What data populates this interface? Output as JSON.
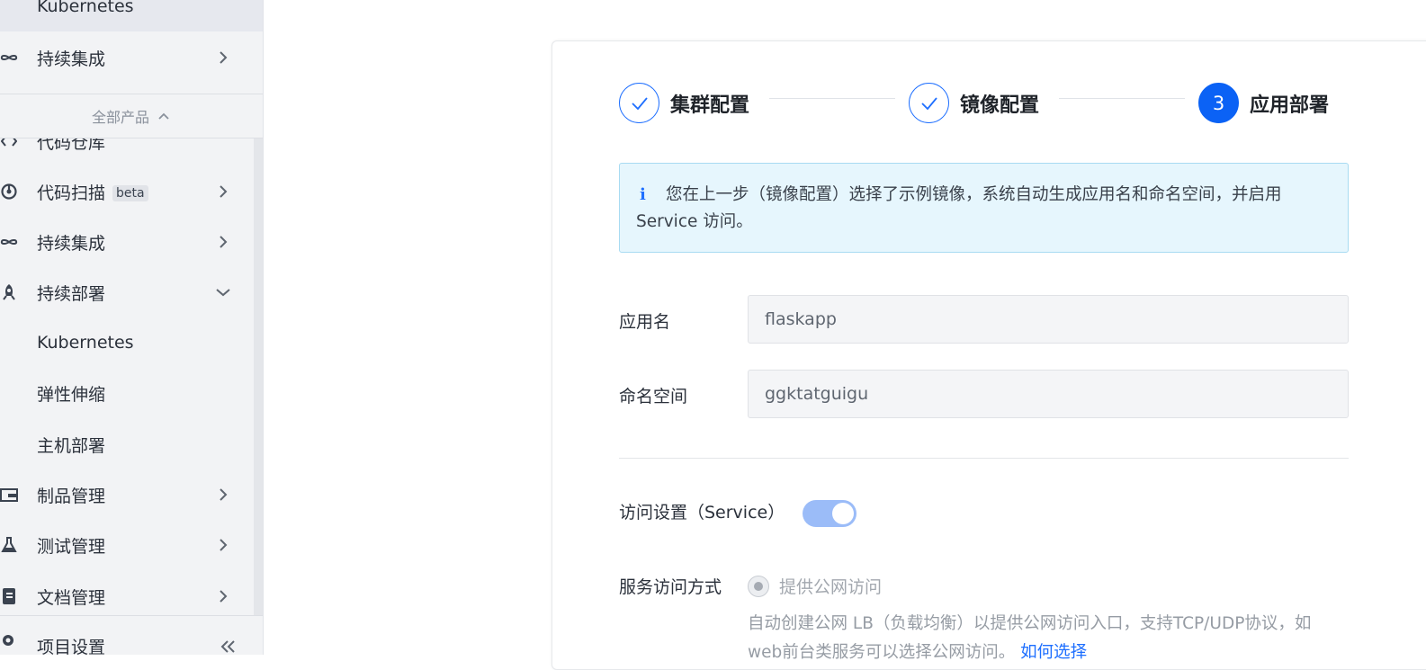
{
  "sidebar": {
    "top_items": [
      {
        "label": "Kubernetes"
      },
      {
        "label": "持续集成",
        "icon": "infinity-icon"
      }
    ],
    "all_products": "全部产品",
    "items": [
      {
        "label": "代码仓库",
        "icon": "code-icon"
      },
      {
        "label": "代码扫描",
        "badge": "beta",
        "icon": "scan-icon"
      },
      {
        "label": "持续集成",
        "icon": "infinity-icon"
      },
      {
        "label": "持续部署",
        "icon": "rocket-icon"
      },
      {
        "label": "Kubernetes"
      },
      {
        "label": "弹性伸缩"
      },
      {
        "label": "主机部署"
      },
      {
        "label": "制品管理",
        "icon": "box-icon"
      },
      {
        "label": "测试管理",
        "icon": "test-icon"
      },
      {
        "label": "文档管理",
        "icon": "doc-icon"
      }
    ],
    "bottom_label": "项目设置"
  },
  "steps": [
    {
      "label": "集群配置",
      "state": "done"
    },
    {
      "label": "镜像配置",
      "state": "done"
    },
    {
      "number": "3",
      "label": "应用部署",
      "state": "active"
    }
  ],
  "info": {
    "icon": "info-icon",
    "text": "您在上一步（镜像配置）选择了示例镜像，系统自动生成应用名和命名空间，并启用 Service 访问。"
  },
  "form": {
    "app_name_label": "应用名",
    "app_name_value": "flaskapp",
    "namespace_label": "命名空间",
    "namespace_value": "ggktatguigu",
    "service_label": "访问设置（Service）",
    "service_enabled": true,
    "access_method_label": "服务访问方式",
    "access_option": "提供公网访问",
    "access_desc": "自动创建公网 LB（负载均衡）以提供公网访问入口，支持TCP/UDP协议，如web前台类服务可以选择公网访问。",
    "access_link": "如何选择"
  },
  "colors": {
    "primary": "#0b62f5",
    "info_bg": "#e6f6fd",
    "toggle_on": "#9bbcf8",
    "sidebar_bg": "#f2f3f5"
  }
}
